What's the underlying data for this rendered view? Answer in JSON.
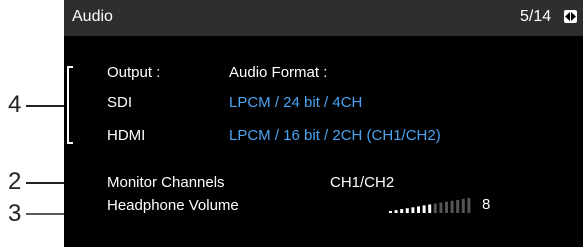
{
  "header": {
    "title": "Audio",
    "page_indicator": "5/14",
    "page_icon": "left-right-arrows-icon"
  },
  "output_section": {
    "output_label": "Output :",
    "format_label": "Audio Format :",
    "rows": [
      {
        "label": "SDI",
        "value": "LPCM / 24 bit / 4CH"
      },
      {
        "label": "HDMI",
        "value": "LPCM / 16 bit / 2CH (CH1/CH2)"
      }
    ]
  },
  "monitor_channels": {
    "label": "Monitor Channels",
    "value": "CH1/CH2"
  },
  "headphone_volume": {
    "label": "Headphone Volume",
    "level": 8,
    "max_level": 15,
    "display": "8"
  },
  "callouts": {
    "c4": "4",
    "c2": "2",
    "c3": "3"
  },
  "colors": {
    "value_blue": "#4aa3f0",
    "title_bar": "#2e2e2e",
    "screen_bg": "#000000"
  }
}
